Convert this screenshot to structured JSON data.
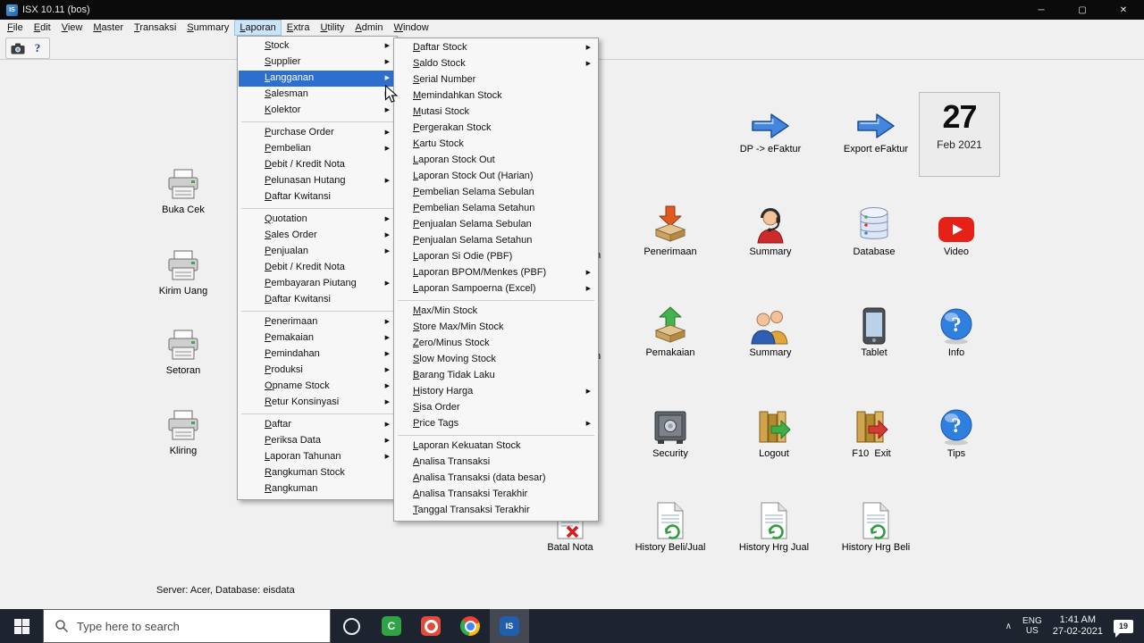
{
  "titlebar": {
    "title": "ISX 10.11 (bos)"
  },
  "menubar": {
    "items": [
      "File",
      "Edit",
      "View",
      "Master",
      "Transaksi",
      "Summary",
      "Laporan",
      "Extra",
      "Utility",
      "Admin",
      "Window"
    ],
    "active": "Laporan"
  },
  "toolbar": {
    "buttons": [
      "camera-icon",
      "help-icon"
    ]
  },
  "laporan_menu": {
    "groups": [
      {
        "items": [
          {
            "label": "Stock",
            "arrow": true
          },
          {
            "label": "Supplier",
            "arrow": true
          },
          {
            "label": "Langganan",
            "arrow": true,
            "selected": true
          },
          {
            "label": "Salesman",
            "arrow": true
          },
          {
            "label": "Kolektor",
            "arrow": true
          }
        ]
      },
      {
        "items": [
          {
            "label": "Purchase Order",
            "arrow": true
          },
          {
            "label": "Pembelian",
            "arrow": true
          },
          {
            "label": "Debit / Kredit Nota"
          },
          {
            "label": "Pelunasan Hutang",
            "arrow": true
          },
          {
            "label": "Daftar Kwitansi"
          }
        ]
      },
      {
        "items": [
          {
            "label": "Quotation",
            "arrow": true
          },
          {
            "label": "Sales Order",
            "arrow": true
          },
          {
            "label": "Penjualan",
            "arrow": true
          },
          {
            "label": "Debit / Kredit Nota"
          },
          {
            "label": "Pembayaran Piutang",
            "arrow": true
          },
          {
            "label": "Daftar Kwitansi"
          }
        ]
      },
      {
        "items": [
          {
            "label": "Penerimaan",
            "arrow": true
          },
          {
            "label": "Pemakaian",
            "arrow": true
          },
          {
            "label": "Pemindahan",
            "arrow": true
          },
          {
            "label": "Produksi",
            "arrow": true
          },
          {
            "label": "Opname Stock",
            "arrow": true
          },
          {
            "label": "Retur Konsinyasi",
            "arrow": true
          }
        ]
      },
      {
        "items": [
          {
            "label": "Daftar",
            "arrow": true
          },
          {
            "label": "Periksa Data",
            "arrow": true
          },
          {
            "label": "Laporan Tahunan",
            "arrow": true
          },
          {
            "label": "Rangkuman Stock"
          },
          {
            "label": "Rangkuman"
          }
        ]
      }
    ]
  },
  "stock_submenu": {
    "groups": [
      {
        "items": [
          {
            "label": "Daftar Stock",
            "arrow": true
          },
          {
            "label": "Saldo Stock",
            "arrow": true
          },
          {
            "label": "Serial Number"
          },
          {
            "label": "Memindahkan Stock"
          },
          {
            "label": "Mutasi Stock"
          },
          {
            "label": "Pergerakan Stock"
          },
          {
            "label": "Kartu Stock"
          },
          {
            "label": "Laporan Stock Out"
          },
          {
            "label": "Laporan Stock Out (Harian)"
          },
          {
            "label": "Pembelian Selama Sebulan"
          },
          {
            "label": "Pembelian Selama Setahun"
          },
          {
            "label": "Penjualan Selama Sebulan"
          },
          {
            "label": "Penjualan Selama Setahun"
          },
          {
            "label": "Laporan Si Odie (PBF)"
          },
          {
            "label": "Laporan BPOM/Menkes (PBF)",
            "arrow": true
          },
          {
            "label": "Laporan Sampoerna (Excel)",
            "arrow": true
          }
        ]
      },
      {
        "items": [
          {
            "label": "Max/Min Stock"
          },
          {
            "label": "Store Max/Min Stock"
          },
          {
            "label": "Zero/Minus Stock"
          },
          {
            "label": "Slow Moving Stock"
          },
          {
            "label": "Barang Tidak Laku"
          },
          {
            "label": "History Harga",
            "arrow": true
          },
          {
            "label": "Sisa Order"
          },
          {
            "label": "Price Tags",
            "arrow": true
          }
        ]
      },
      {
        "items": [
          {
            "label": "Laporan Kekuatan Stock"
          },
          {
            "label": "Analisa Transaksi"
          },
          {
            "label": "Analisa Transaksi (data besar)"
          },
          {
            "label": "Analisa Transaksi Terakhir"
          },
          {
            "label": "Tanggal Transaksi Terakhir"
          }
        ]
      }
    ]
  },
  "desktop": {
    "left_icons": [
      {
        "label": "Buka Cek",
        "icon": "printer-icon"
      },
      {
        "label": "Kirim Uang",
        "icon": "printer-icon"
      },
      {
        "label": "Setoran",
        "icon": "printer-icon"
      },
      {
        "label": "Kliring",
        "icon": "printer-icon"
      }
    ],
    "grid_icons": [
      {
        "label": "DP -> eFaktur",
        "icon": "blue-arrow-icon"
      },
      {
        "label": "Export eFaktur",
        "icon": "blue-arrow-icon"
      },
      {
        "label": "Penerimaan",
        "icon": "receive-box-icon"
      },
      {
        "label": "Summary",
        "icon": "person-headset-icon"
      },
      {
        "label": "Database",
        "icon": "database-icon"
      },
      {
        "label": "Video",
        "icon": "youtube-icon"
      },
      {
        "label": "Pemakaian",
        "icon": "dispatch-box-icon"
      },
      {
        "label": "Summary",
        "icon": "people-icon"
      },
      {
        "label": "Tablet",
        "icon": "tablet-icon"
      },
      {
        "label": "Info",
        "icon": "question-icon"
      },
      {
        "label": "Security",
        "icon": "safe-icon"
      },
      {
        "label": "Logout",
        "icon": "logout-icon"
      },
      {
        "label": "F10  Exit",
        "icon": "exit-icon"
      },
      {
        "label": "Tips",
        "icon": "question-icon"
      },
      {
        "label": "Batal Nota",
        "icon": "cancel-note-icon"
      },
      {
        "label": "History Beli/Jual",
        "icon": "history-doc-icon"
      },
      {
        "label": "History Hrg Jual",
        "icon": "history-doc-icon"
      },
      {
        "label": "History Hrg Beli",
        "icon": "history-doc-icon"
      }
    ],
    "calendar": {
      "day": "27",
      "month_year": "Feb 2021"
    },
    "partial_labels": [
      "n",
      "n"
    ]
  },
  "statusbar": {
    "text": "Server: Acer,  Database: eisdata"
  },
  "taskbar": {
    "search_placeholder": "Type here to search",
    "apps": [
      {
        "name": "green-app-icon"
      },
      {
        "name": "red-recorder-icon"
      },
      {
        "name": "chrome-icon"
      },
      {
        "name": "isx-app-icon",
        "active": true
      }
    ],
    "tray": {
      "chevron": "∧",
      "lang_top": "ENG",
      "lang_bottom": "US",
      "time": "1:41 AM",
      "date": "27-02-2021",
      "notification_count": "19"
    }
  }
}
